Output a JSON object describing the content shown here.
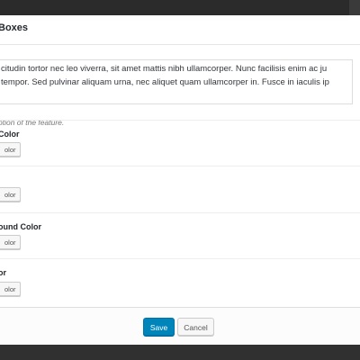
{
  "dialog": {
    "title": "Boxes",
    "text_lines": [
      "citudin tortor nec leo viverra, sit amet mattis nibh ullamcorper. Nunc facilisis enim ac ju",
      "tempor. Sed pulvinar aliquam urna, nec aliquet quam ullamcorper in. Fusce in iaculis ip"
    ],
    "description": "ption of the feature."
  },
  "fields": [
    {
      "label": "Color",
      "button": "olor"
    },
    {
      "label": "",
      "button": "olor"
    },
    {
      "label": "ound Color",
      "button": "olor"
    },
    {
      "label": "or",
      "button": "olor"
    }
  ],
  "footer": {
    "save_label": "Save",
    "cancel_label": "Cancel"
  },
  "colors": {
    "primary": "#0085ba",
    "overlay": "#303030"
  }
}
